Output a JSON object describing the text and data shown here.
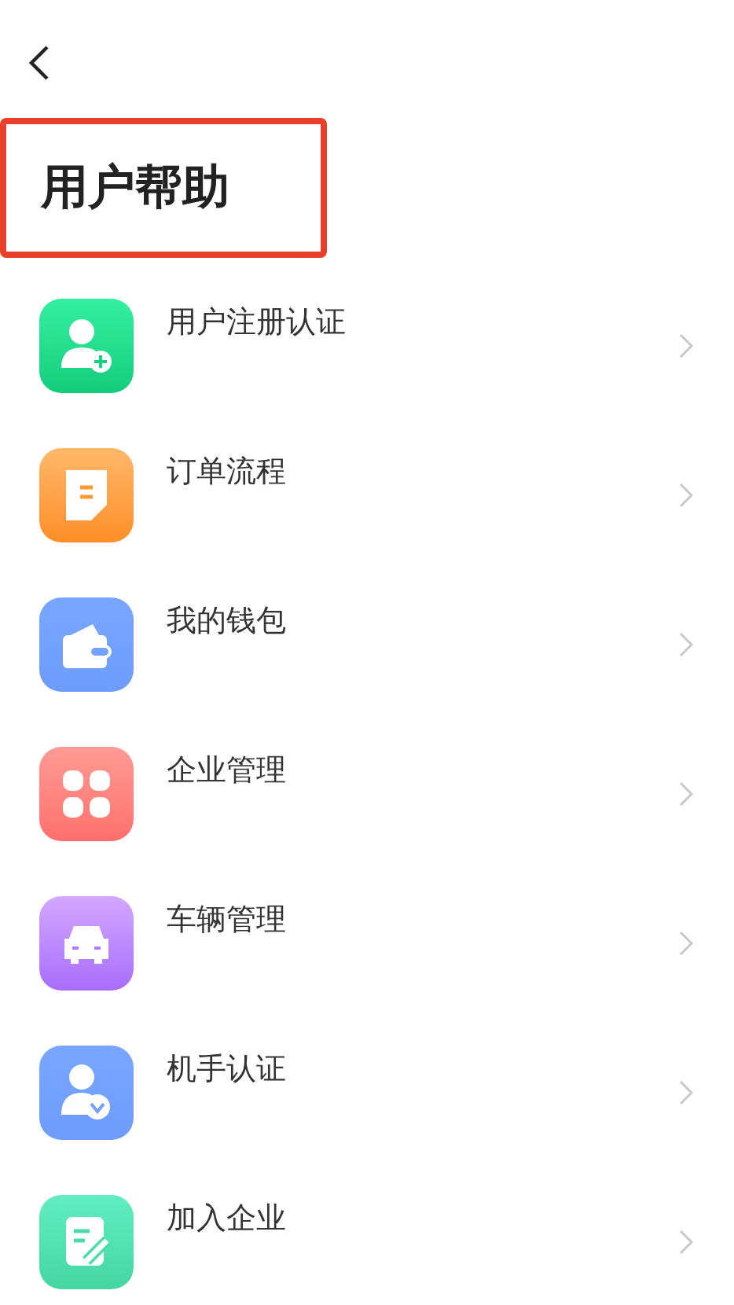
{
  "title": {
    "text": "用户帮助",
    "highlighted": true
  },
  "items": [
    {
      "label": "用户注册认证",
      "kind": "user-add"
    },
    {
      "label": "订单流程",
      "kind": "document"
    },
    {
      "label": "我的钱包",
      "kind": "wallet"
    },
    {
      "label": "企业管理",
      "kind": "grid"
    },
    {
      "label": "车辆管理",
      "kind": "car"
    },
    {
      "label": "机手认证",
      "kind": "user-check"
    },
    {
      "label": "加入企业",
      "kind": "edit"
    }
  ]
}
